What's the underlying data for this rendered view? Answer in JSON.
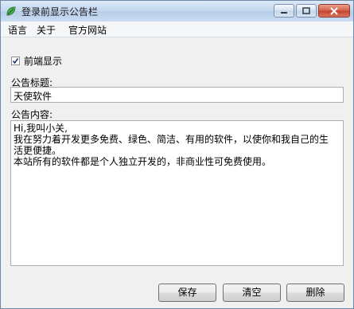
{
  "window": {
    "title": "登录前显示公告栏",
    "app_icon": "leaf-icon",
    "controls": [
      "minimize-icon",
      "maximize-icon",
      "close-icon"
    ]
  },
  "menu": {
    "items": [
      {
        "label": "语言"
      },
      {
        "label": "关于"
      },
      {
        "label": "官方网站"
      }
    ]
  },
  "form": {
    "show_checkbox": {
      "label": "前端显示",
      "checked": true
    },
    "title_label": "公告标题:",
    "title_value": "天使软件",
    "content_label": "公告内容:",
    "content_lines": [
      "Hi,我叫小关,",
      "我在努力着开发更多免费、绿色、简洁、有用的软件，以使你和我自己的生",
      "活更便捷。",
      "本站所有的软件都是个人独立开发的，非商业性可免费使用。"
    ]
  },
  "buttons": {
    "save": "保存",
    "clear": "清空",
    "delete": "删除"
  }
}
